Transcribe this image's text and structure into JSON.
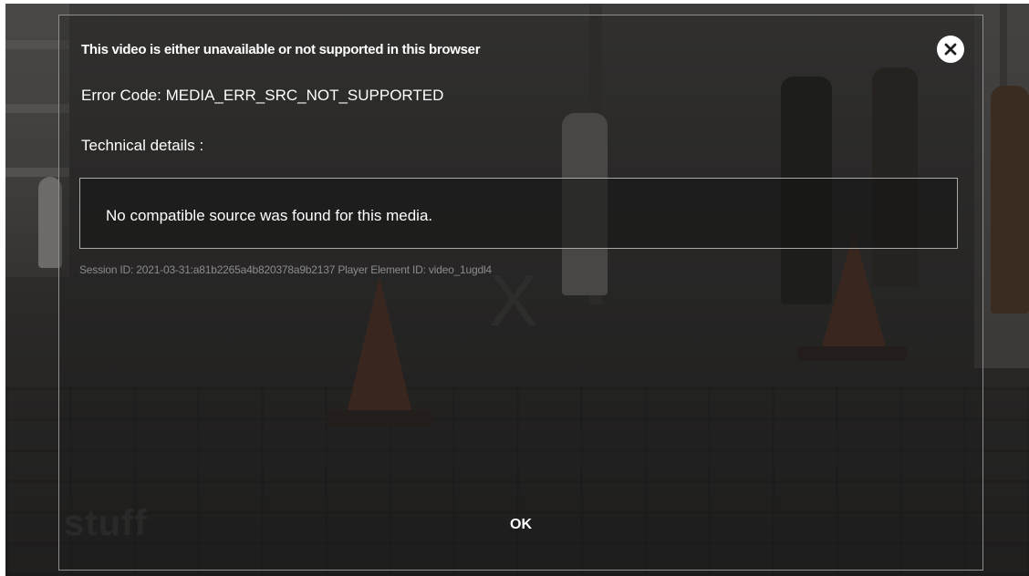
{
  "dialog": {
    "title": "This video is either unavailable or not supported in this browser",
    "error_code": "Error Code: MEDIA_ERR_SRC_NOT_SUPPORTED",
    "technical_label": "Technical details :",
    "details": "No compatible source was found for this media.",
    "session_info": "Session ID: 2021-03-31:a81b2265a4b820378a9b2137 Player Element ID: video_1ugdl4",
    "ok_label": "OK",
    "close_icon": "close-icon"
  },
  "player": {
    "watermark": "stuff",
    "placeholder_glyph": "X"
  },
  "colors": {
    "overlay": "#141414",
    "text": "#ffffff",
    "muted_text": "#8c8c8c",
    "border": "#a9a9a9",
    "close_button_bg": "#ffffff"
  }
}
